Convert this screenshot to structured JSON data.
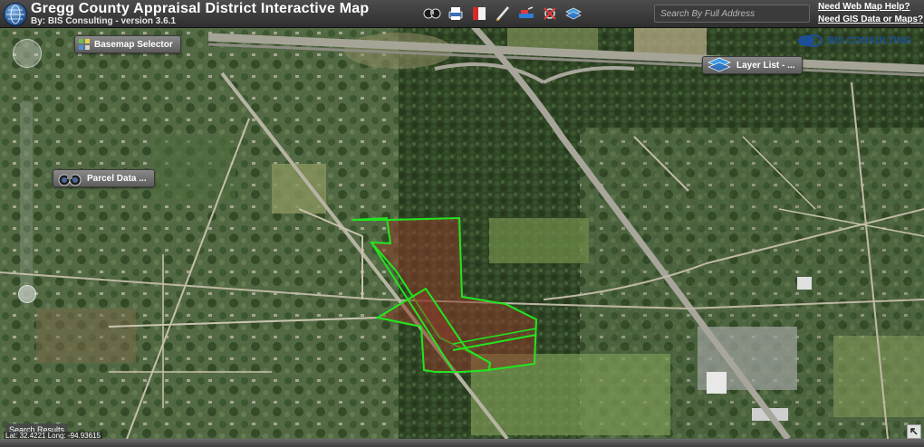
{
  "header": {
    "title": "Gregg County Appraisal District Interactive Map",
    "subtitle": "By: BIS Consulting - version 3.6.1",
    "logo_icon": "globe-icon",
    "toolbar": [
      {
        "name": "identify-tool-icon"
      },
      {
        "name": "print-tool-icon"
      },
      {
        "name": "bookmark-tool-icon"
      },
      {
        "name": "draw-tool-icon"
      },
      {
        "name": "measure-tool-icon"
      },
      {
        "name": "clear-tool-icon"
      },
      {
        "name": "layers-tool-icon"
      }
    ]
  },
  "search": {
    "placeholder": "Search By Full Address",
    "value": ""
  },
  "help": {
    "web_map_help": "Need Web Map Help?",
    "gis_data": "Need GIS Data or Maps?"
  },
  "map": {
    "basemap_button": "Basemap Selector",
    "layer_list_button": "Layer List - ...",
    "parcel_data_button": "Parcel Data ...",
    "brand": "BIS CONSULTING",
    "search_results": "Search Results",
    "coordinates": "Lat: 32.4221 Long: -94.93615",
    "parcel_outline_color": "#22e61e",
    "parcel_fill_color": "#8b3a2a",
    "expand_icon": "expand-arrow-icon"
  }
}
